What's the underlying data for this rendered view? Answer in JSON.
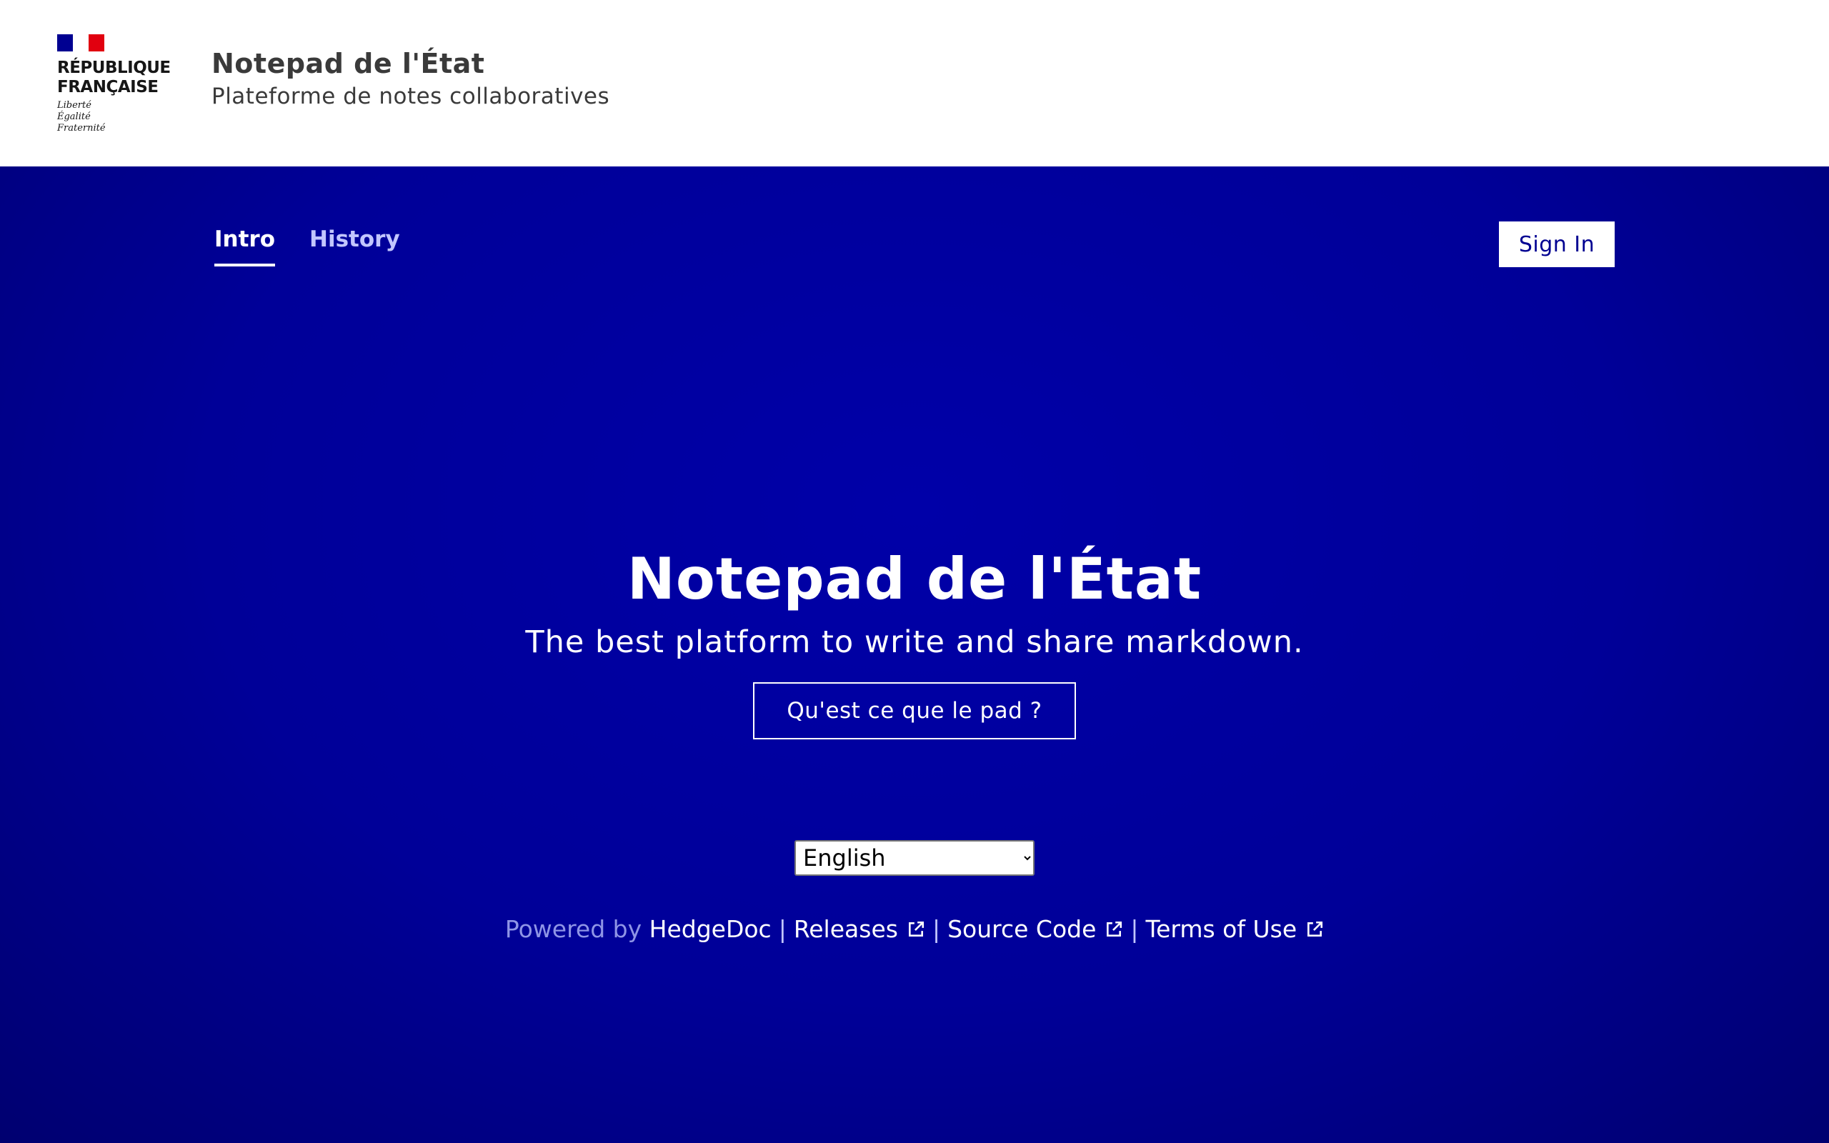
{
  "header": {
    "logo": {
      "line1": "RÉPUBLIQUE",
      "line2": "FRANÇAISE",
      "motto": [
        "Liberté",
        "Égalité",
        "Fraternité"
      ],
      "flag_colors": [
        "#000091",
        "#ffffff",
        "#e1000f"
      ]
    },
    "title": "Notepad de l'État",
    "tagline": "Plateforme de notes collaboratives"
  },
  "nav": {
    "tabs": [
      {
        "label": "Intro",
        "active": true
      },
      {
        "label": "History",
        "active": false
      }
    ],
    "signin_label": "Sign In"
  },
  "hero": {
    "title": "Notepad de l'État",
    "subtitle": "The best platform to write and share markdown.",
    "button_label": "Qu'est ce que le pad ?"
  },
  "language": {
    "selected": "English"
  },
  "footer": {
    "powered_by": "Powered by",
    "hedgedoc": "HedgeDoc",
    "separator": "|",
    "releases": "Releases",
    "source_code": "Source Code",
    "terms": "Terms of Use",
    "link_icon": "external-link-icon"
  },
  "colors": {
    "primary": "#000091",
    "header_bg": "#ffffff",
    "text_dark": "#3a3a3a"
  }
}
